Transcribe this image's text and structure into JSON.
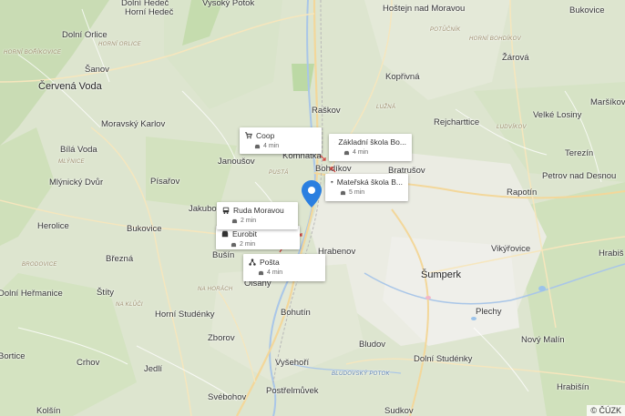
{
  "map": {
    "copyright": "© ČÚZK",
    "place_labels": [
      {
        "text": "Dolní Hedeč",
        "cls": "town"
      },
      {
        "text": "Vysoký Potok",
        "cls": "town"
      },
      {
        "text": "Horní Hedeč",
        "cls": "town"
      },
      {
        "text": "Hoštejn nad Moravou",
        "cls": "town"
      },
      {
        "text": "Bukovice",
        "cls": "town"
      },
      {
        "text": "Dolní Orlice",
        "cls": "town"
      },
      {
        "text": "Horní Orlice",
        "cls": "area"
      },
      {
        "text": "Horní Boříkovice",
        "cls": "area"
      },
      {
        "text": "Potůčník",
        "cls": "area"
      },
      {
        "text": "Horní Bohdíkov",
        "cls": "area"
      },
      {
        "text": "Šanov",
        "cls": "town"
      },
      {
        "text": "Žárová",
        "cls": "town"
      },
      {
        "text": "Kopřivná",
        "cls": "town"
      },
      {
        "text": "Červená Voda",
        "cls": "city"
      },
      {
        "text": "Raškov",
        "cls": "town"
      },
      {
        "text": "Lužná",
        "cls": "area"
      },
      {
        "text": "Velké Losiny",
        "cls": "town"
      },
      {
        "text": "Maršíkov",
        "cls": "town"
      },
      {
        "text": "Moravský Karlov",
        "cls": "town"
      },
      {
        "text": "Rejcharttice",
        "cls": "town"
      },
      {
        "text": "Ludvíkov",
        "cls": "area"
      },
      {
        "text": "Bílá Voda",
        "cls": "town"
      },
      {
        "text": "Terezín",
        "cls": "town"
      },
      {
        "text": "Janoušov",
        "cls": "town"
      },
      {
        "text": "Mlýnice",
        "cls": "area"
      },
      {
        "text": "Bratrušov",
        "cls": "town"
      },
      {
        "text": "Pustá",
        "cls": "area"
      },
      {
        "text": "Petrov nad Desnou",
        "cls": "town"
      },
      {
        "text": "Mlýnický Dvůr",
        "cls": "town"
      },
      {
        "text": "Písařov",
        "cls": "town"
      },
      {
        "text": "Rapotín",
        "cls": "town"
      },
      {
        "text": "Jakubovice",
        "cls": "town"
      },
      {
        "text": "Herolice",
        "cls": "town"
      },
      {
        "text": "Bukovice",
        "cls": "town"
      },
      {
        "text": "Hrabenov",
        "cls": "town"
      },
      {
        "text": "Vikýřovice",
        "cls": "town"
      },
      {
        "text": "Hrabiš",
        "cls": "town"
      },
      {
        "text": "Březná",
        "cls": "town"
      },
      {
        "text": "Bušín",
        "cls": "town"
      },
      {
        "text": "Šumperk",
        "cls": "city"
      },
      {
        "text": "Brodovice",
        "cls": "area"
      },
      {
        "text": "Dolní Heřmanice",
        "cls": "town"
      },
      {
        "text": "Štíty",
        "cls": "town"
      },
      {
        "text": "Na Horách",
        "cls": "area"
      },
      {
        "text": "Olšany",
        "cls": "town"
      },
      {
        "text": "Bohutín",
        "cls": "town"
      },
      {
        "text": "Plechy",
        "cls": "town"
      },
      {
        "text": "Na Klůči",
        "cls": "area"
      },
      {
        "text": "Horní Studénky",
        "cls": "town"
      },
      {
        "text": "Zborov",
        "cls": "town"
      },
      {
        "text": "Bludov",
        "cls": "town"
      },
      {
        "text": "Nový Malín",
        "cls": "town"
      },
      {
        "text": "Bortice",
        "cls": "town"
      },
      {
        "text": "Crhov",
        "cls": "town"
      },
      {
        "text": "Jedlí",
        "cls": "town"
      },
      {
        "text": "Vyšehoří",
        "cls": "town"
      },
      {
        "text": "Dolní Studénky",
        "cls": "town"
      },
      {
        "text": "Bludovský Potok",
        "cls": "water"
      },
      {
        "text": "Svébohov",
        "cls": "town"
      },
      {
        "text": "Postřelmůvek",
        "cls": "town"
      },
      {
        "text": "Sudkov",
        "cls": "town"
      },
      {
        "text": "Hrabišín",
        "cls": "town"
      },
      {
        "text": "Kolšín",
        "cls": "town"
      },
      {
        "text": "Bohdíkov",
        "cls": "town"
      },
      {
        "text": "Komňátka",
        "cls": "town"
      }
    ]
  },
  "poi_cards": [
    {
      "title": "Coop",
      "icon": "cart-icon",
      "time": "4 min"
    },
    {
      "title": "Základní škola Bo...",
      "icon": "school-icon",
      "time": "4 min"
    },
    {
      "title": "Mateřská škola B...",
      "icon": "school-icon",
      "time": "5 min"
    },
    {
      "title": "Ruda Moravou",
      "icon": "bus-icon",
      "time": "2 min"
    },
    {
      "title": "Eurobit",
      "icon": "shop-icon",
      "time": "2 min"
    },
    {
      "title": "Pošta",
      "icon": "post-icon",
      "time": "4 min"
    }
  ]
}
